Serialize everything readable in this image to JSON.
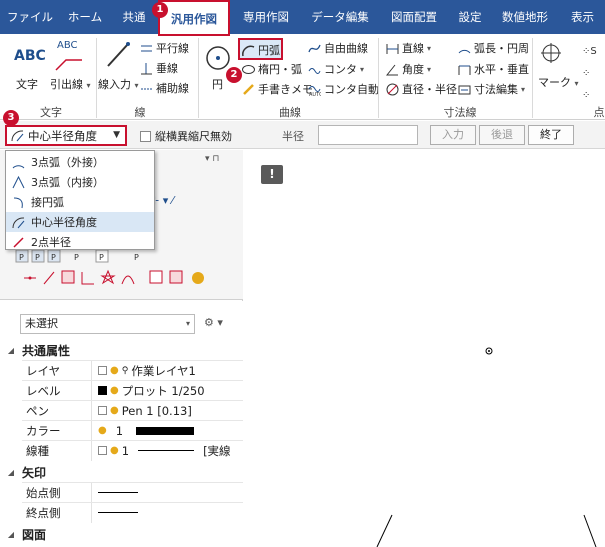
{
  "tabs": [
    "ファイル",
    "ホーム",
    "共通",
    "汎用作図",
    "専用作図",
    "データ編集",
    "図面配置",
    "設定",
    "数値地形",
    "表示"
  ],
  "badges": [
    "1",
    "2",
    "3"
  ],
  "ribbon": {
    "group_labels": {
      "text": "文字",
      "line": "線",
      "curve": "曲線",
      "dimension": "寸法線",
      "point": "点"
    },
    "text_group": {
      "abc": "ABC",
      "abc2": "ABC",
      "text": "文字",
      "leader": "引出線"
    },
    "line_group": {
      "line_input": "線入力",
      "parallel": "平行線",
      "vertical": "垂線",
      "auxiliary": "補助線"
    },
    "curve_group": {
      "circle": "円",
      "arc": "円弧",
      "ellipse": "楕円・弧",
      "handwrite": "手書きメモ",
      "free_curve": "自由曲線",
      "conta": "コンタ",
      "conta_auto": "コンタ自動"
    },
    "dim_group": {
      "straight": "直線",
      "angle": "角度",
      "diameter": "直径・半径",
      "arc_length": "弧長・円周",
      "horizontal": "水平・垂直",
      "dim_edit": "寸法編集"
    },
    "mark_group": {
      "mark": "マーク"
    }
  },
  "cmdbar": {
    "mode_selected": "中心半径角度",
    "checkbox_label": "縦横異縮尺無効",
    "radius_label": "半径",
    "radius_value": "",
    "input_btn": "入力",
    "back_btn": "後退",
    "end_btn": "終了"
  },
  "popup_items": [
    "3点弧（外接）",
    "3点弧（内接）",
    "接円弧",
    "中心半径角度",
    "2点半径"
  ],
  "panel": {
    "select_value": "未選択",
    "sections": {
      "common": "共通属性",
      "arrow": "矢印",
      "drawing": "図面"
    },
    "rows": {
      "layer_k": "レイヤ",
      "layer_v": "作業レイヤ1",
      "level_k": "レベル",
      "level_v": "プロット 1/250",
      "pen_k": "ペン",
      "pen_v": "Pen 1 [0.13]",
      "color_k": "カラー",
      "color_v": "1",
      "linetype_k": "線種",
      "linetype_v": "1",
      "linetype_v2": "[実線",
      "start_k": "始点側",
      "end_k": "終点側"
    }
  },
  "colors": {
    "tab_bg": "#2b579a",
    "highlight": "#c8102e"
  }
}
